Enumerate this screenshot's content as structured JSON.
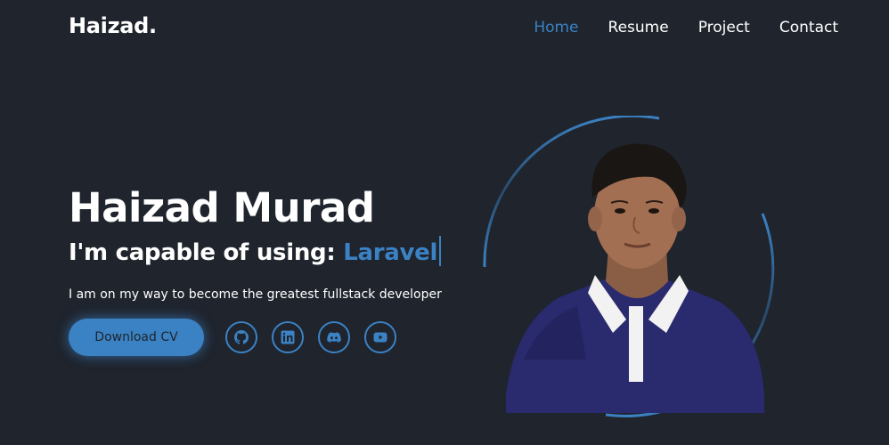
{
  "header": {
    "logo": "Haizad.",
    "nav": [
      "Home",
      "Resume",
      "Project",
      "Contact"
    ],
    "active_nav": "Home"
  },
  "hero": {
    "name": "Haizad Murad",
    "subtitle_prefix": "I'm capable of using:",
    "skill": "Laravel",
    "description": "I am on my way to become the greatest fullstack developer"
  },
  "cta": {
    "download_label": "Download CV"
  },
  "socials": [
    {
      "name": "github",
      "icon": "github-icon"
    },
    {
      "name": "linkedin",
      "icon": "linkedin-icon"
    },
    {
      "name": "discord",
      "icon": "discord-icon"
    },
    {
      "name": "youtube",
      "icon": "youtube-icon"
    }
  ],
  "colors": {
    "background": "#1f242d",
    "accent": "#3b82c4",
    "text": "#ffffff"
  }
}
